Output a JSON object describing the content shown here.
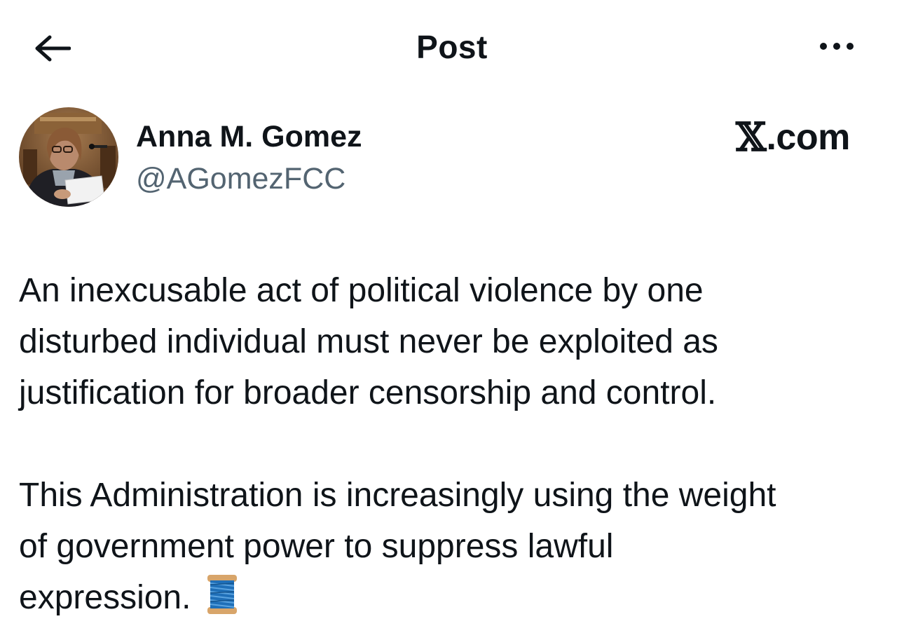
{
  "header": {
    "title": "Post",
    "back_icon": "arrow-left-icon",
    "more_icon": "more-horizontal-icon"
  },
  "author": {
    "display_name": "Anna M. Gomez",
    "handle": "@AGomezFCC",
    "avatar": "profile-photo"
  },
  "brand": {
    "logo_letter": "𝕏",
    "logo_suffix": ".com"
  },
  "post": {
    "paragraphs": [
      "An inexcusable act of political violence by one\ndisturbed individual must never be exploited as\njustification for broader censorship and control.",
      "This Administration is increasingly using the weight\nof government power to suppress lawful\nexpression."
    ],
    "emoji": "thread-spool-emoji"
  },
  "colors": {
    "text": "#0f1419",
    "secondary": "#536471",
    "background": "#ffffff"
  }
}
